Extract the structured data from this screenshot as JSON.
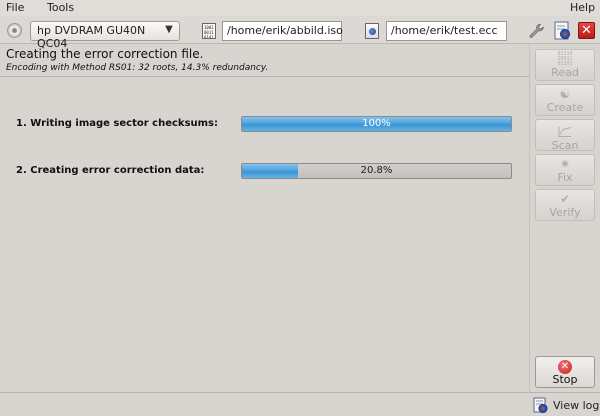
{
  "menu": {
    "file": "File",
    "tools": "Tools",
    "help": "Help"
  },
  "toolbar": {
    "drive": "hp DVDRAM GU40N QC04",
    "image_path": "/home/erik/abbild.iso",
    "ecc_path": "/home/erik/test.ecc",
    "file_icon_bits": "1001\n0011\n0101"
  },
  "main": {
    "title": "Creating the error correction file.",
    "subtitle": "Encoding with Method RS01: 32 roots, 14.3% redundancy.",
    "steps": [
      {
        "label": "1. Writing image sector checksums:",
        "progress": 1.0,
        "text": "100%"
      },
      {
        "label": "2. Creating error correction data:",
        "progress": 0.208,
        "text": "20.8%"
      }
    ]
  },
  "sidebar": {
    "read": {
      "label": "Read",
      "icon_bits": "01110\n10011\n01101",
      "enabled": false
    },
    "create": {
      "label": "Create",
      "enabled": false
    },
    "scan": {
      "label": "Scan",
      "enabled": false
    },
    "fix": {
      "label": "Fix",
      "enabled": false
    },
    "verify": {
      "label": "Verify",
      "enabled": false
    },
    "stop": {
      "label": "Stop",
      "enabled": true
    }
  },
  "status": {
    "view_log": "View log"
  },
  "colors": {
    "progress_fill": "#4ea3dc",
    "stop_red": "#c41f1f",
    "background": "#d8d4d0"
  }
}
